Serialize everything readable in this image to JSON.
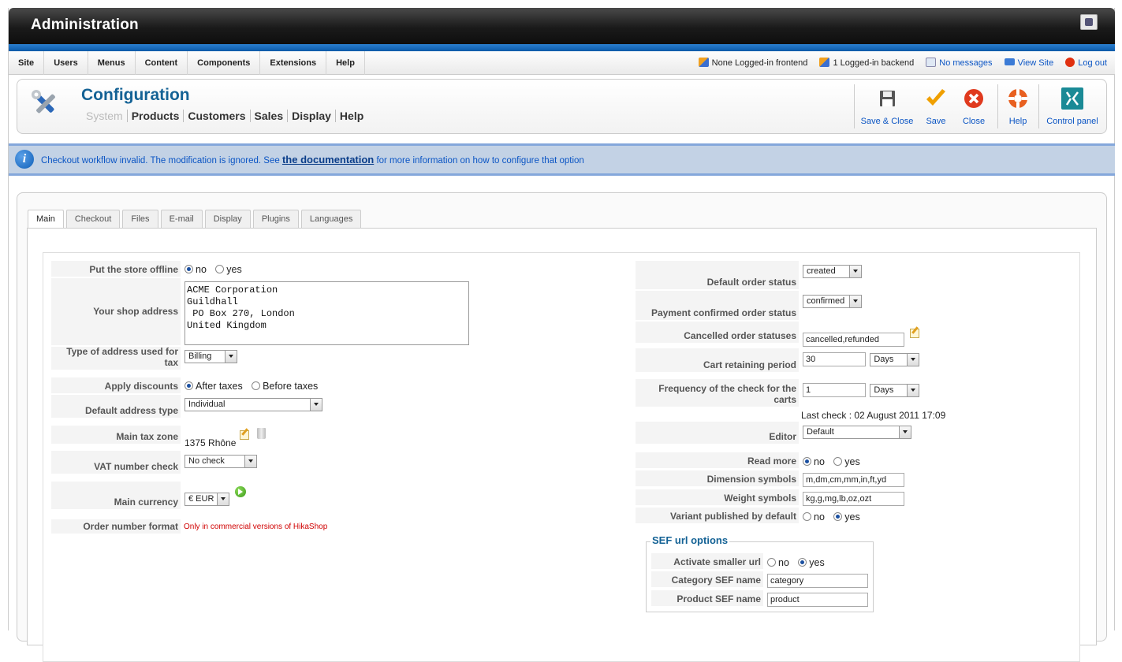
{
  "header": {
    "title": "Administration"
  },
  "menu": [
    "Site",
    "Users",
    "Menus",
    "Content",
    "Components",
    "Extensions",
    "Help"
  ],
  "status": {
    "frontend": "None Logged-in frontend",
    "backend": "1 Logged-in backend",
    "messages": "No messages",
    "view_site": "View Site",
    "logout": "Log out"
  },
  "toolbar": {
    "title": "Configuration",
    "submenu": [
      "System",
      "Products",
      "Customers",
      "Sales",
      "Display",
      "Help"
    ],
    "buttons": {
      "save_close": "Save & Close",
      "save": "Save",
      "close": "Close",
      "help": "Help",
      "control_panel": "Control panel"
    }
  },
  "notice": {
    "before": "Checkout workflow invalid. The modification is ignored. See ",
    "link": "the documentation",
    "after": " for more information on how to configure that option"
  },
  "tabs": [
    "Main",
    "Checkout",
    "Files",
    "E-mail",
    "Display",
    "Plugins",
    "Languages"
  ],
  "left": {
    "offline": {
      "label": "Put the store offline",
      "no": "no",
      "yes": "yes"
    },
    "address": {
      "label": "Your shop address",
      "value": "ACME Corporation\nGuildhall\n PO Box 270, London\nUnited Kingdom"
    },
    "tax_address": {
      "label": "Type of address used for tax",
      "value": "Billing"
    },
    "discounts": {
      "label": "Apply discounts",
      "after": "After taxes",
      "before": "Before taxes"
    },
    "address_type": {
      "label": "Default address type",
      "value": "Individual"
    },
    "tax_zone": {
      "label": "Main tax zone",
      "value": "1375 Rhône"
    },
    "vat": {
      "label": "VAT number check",
      "value": "No check"
    },
    "currency": {
      "label": "Main currency",
      "value": "€ EUR"
    },
    "order_format": {
      "label": "Order number format",
      "value": "Only in commercial versions of HikaShop"
    }
  },
  "right": {
    "default_status": {
      "label": "Default order status",
      "value": "created"
    },
    "confirmed_status": {
      "label": "Payment confirmed order status",
      "value": "confirmed"
    },
    "cancelled": {
      "label": "Cancelled order statuses",
      "value": "cancelled,refunded"
    },
    "cart_period": {
      "label": "Cart retaining period",
      "value": "30",
      "unit": "Days"
    },
    "check_freq": {
      "label": "Frequency of the check for the carts",
      "value": "1",
      "unit": "Days",
      "last_check": "Last check : 02 August 2011 17:09"
    },
    "editor": {
      "label": "Editor",
      "value": "Default"
    },
    "read_more": {
      "label": "Read more",
      "no": "no",
      "yes": "yes"
    },
    "dimension": {
      "label": "Dimension symbols",
      "value": "m,dm,cm,mm,in,ft,yd"
    },
    "weight": {
      "label": "Weight symbols",
      "value": "kg,g,mg,lb,oz,ozt"
    },
    "variant": {
      "label": "Variant published by default",
      "no": "no",
      "yes": "yes"
    }
  },
  "sef": {
    "legend": "SEF url options",
    "smaller": {
      "label": "Activate smaller url",
      "no": "no",
      "yes": "yes"
    },
    "category": {
      "label": "Category SEF name",
      "value": "category"
    },
    "product": {
      "label": "Product SEF name",
      "value": "product"
    }
  }
}
